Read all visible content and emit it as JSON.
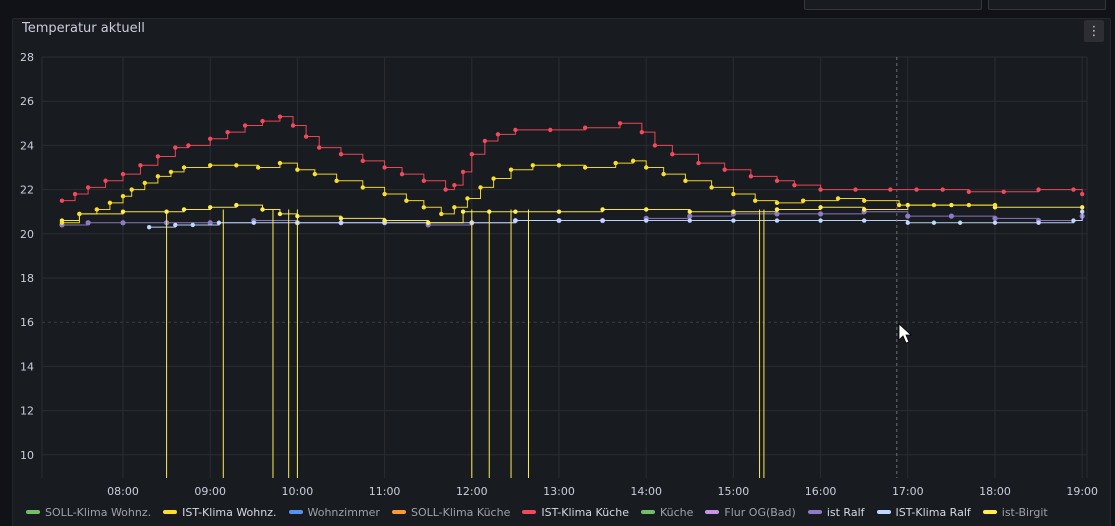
{
  "panel": {
    "title": "Temperatur aktuell",
    "menu_icon": "vertical-ellipsis-icon"
  },
  "chart_data": {
    "type": "line",
    "title": "Temperatur aktuell",
    "xlabel": "",
    "ylabel": "",
    "ylim": [
      9,
      28
    ],
    "y_ticks": [
      10,
      12,
      14,
      16,
      18,
      20,
      22,
      24,
      26,
      28
    ],
    "xlim": [
      "07:15",
      "19:05"
    ],
    "x_ticks": [
      "08:00",
      "09:00",
      "10:00",
      "11:00",
      "12:00",
      "13:00",
      "14:00",
      "15:00",
      "16:00",
      "17:00",
      "18:00",
      "19:00"
    ],
    "grid": true,
    "legend_position": "bottom",
    "series": [
      {
        "name": "SOLL-Klima Wohnz.",
        "color": "#73bf69",
        "values": []
      },
      {
        "name": "IST-Klima Wohnz.",
        "color": "#fade2a",
        "values": [
          [
            7.3,
            20.5
          ],
          [
            7.5,
            20.9
          ],
          [
            7.7,
            21.1
          ],
          [
            7.85,
            21.4
          ],
          [
            8.0,
            21.7
          ],
          [
            8.1,
            22.0
          ],
          [
            8.25,
            22.3
          ],
          [
            8.4,
            22.6
          ],
          [
            8.55,
            22.8
          ],
          [
            8.7,
            23.0
          ],
          [
            9.0,
            23.1
          ],
          [
            9.3,
            23.1
          ],
          [
            9.55,
            23.0
          ],
          [
            9.8,
            23.2
          ],
          [
            10.0,
            22.9
          ],
          [
            10.2,
            22.7
          ],
          [
            10.45,
            22.4
          ],
          [
            10.75,
            22.1
          ],
          [
            11.0,
            21.8
          ],
          [
            11.25,
            21.5
          ],
          [
            11.45,
            21.2
          ],
          [
            11.65,
            20.9
          ],
          [
            11.8,
            21.2
          ],
          [
            11.95,
            21.6
          ],
          [
            12.1,
            22.1
          ],
          [
            12.25,
            22.5
          ],
          [
            12.45,
            22.9
          ],
          [
            12.7,
            23.1
          ],
          [
            13.0,
            23.1
          ],
          [
            13.3,
            23.0
          ],
          [
            13.65,
            23.2
          ],
          [
            13.85,
            23.3
          ],
          [
            14.0,
            23.0
          ],
          [
            14.2,
            22.7
          ],
          [
            14.45,
            22.4
          ],
          [
            14.75,
            22.1
          ],
          [
            15.0,
            21.8
          ],
          [
            15.25,
            21.5
          ],
          [
            15.5,
            21.4
          ],
          [
            15.8,
            21.5
          ],
          [
            16.2,
            21.6
          ],
          [
            16.5,
            21.5
          ],
          [
            16.9,
            21.3
          ],
          [
            17.3,
            21.3
          ],
          [
            17.7,
            21.3
          ],
          [
            18.0,
            21.3
          ]
        ]
      },
      {
        "name": "Wohnzimmer",
        "color": "#5794f2",
        "values": []
      },
      {
        "name": "SOLL-Klima Küche",
        "color": "#ff9830",
        "values": []
      },
      {
        "name": "IST-Klima Küche",
        "color": "#f2495c",
        "values": [
          [
            7.3,
            21.5
          ],
          [
            7.45,
            21.8
          ],
          [
            7.6,
            22.1
          ],
          [
            7.8,
            22.4
          ],
          [
            8.0,
            22.7
          ],
          [
            8.2,
            23.1
          ],
          [
            8.4,
            23.5
          ],
          [
            8.6,
            23.9
          ],
          [
            8.75,
            24.0
          ],
          [
            9.0,
            24.3
          ],
          [
            9.2,
            24.6
          ],
          [
            9.4,
            24.9
          ],
          [
            9.6,
            25.1
          ],
          [
            9.8,
            25.3
          ],
          [
            9.95,
            24.9
          ],
          [
            10.1,
            24.4
          ],
          [
            10.25,
            23.9
          ],
          [
            10.5,
            23.6
          ],
          [
            10.75,
            23.3
          ],
          [
            11.0,
            23.0
          ],
          [
            11.2,
            22.7
          ],
          [
            11.45,
            22.4
          ],
          [
            11.7,
            22.0
          ],
          [
            11.8,
            22.2
          ],
          [
            11.9,
            22.8
          ],
          [
            12.0,
            23.6
          ],
          [
            12.15,
            24.2
          ],
          [
            12.3,
            24.5
          ],
          [
            12.5,
            24.7
          ],
          [
            12.9,
            24.7
          ],
          [
            13.3,
            24.8
          ],
          [
            13.7,
            25.0
          ],
          [
            13.95,
            24.6
          ],
          [
            14.1,
            24.0
          ],
          [
            14.3,
            23.6
          ],
          [
            14.6,
            23.2
          ],
          [
            14.9,
            22.9
          ],
          [
            15.2,
            22.6
          ],
          [
            15.5,
            22.4
          ],
          [
            15.7,
            22.2
          ],
          [
            16.0,
            22.0
          ],
          [
            16.4,
            22.0
          ],
          [
            16.8,
            22.0
          ],
          [
            17.1,
            22.0
          ],
          [
            17.4,
            22.0
          ],
          [
            17.7,
            21.9
          ],
          [
            18.1,
            21.9
          ],
          [
            18.5,
            22.0
          ],
          [
            18.9,
            22.0
          ],
          [
            19.0,
            21.8
          ]
        ]
      },
      {
        "name": "Küche",
        "color": "#73bf69",
        "values": []
      },
      {
        "name": "Flur OG(Bad)",
        "color": "#ca95e5",
        "values": []
      },
      {
        "name": "ist Ralf",
        "color": "#8f7ac7",
        "values": [
          [
            7.3,
            20.4
          ],
          [
            7.6,
            20.5
          ],
          [
            8.0,
            20.5
          ],
          [
            8.5,
            20.5
          ],
          [
            9.0,
            20.5
          ],
          [
            9.5,
            20.6
          ],
          [
            10.0,
            20.5
          ],
          [
            10.5,
            20.5
          ],
          [
            11.0,
            20.5
          ],
          [
            11.5,
            20.4
          ],
          [
            12.0,
            20.5
          ],
          [
            12.5,
            20.6
          ],
          [
            13.0,
            20.6
          ],
          [
            13.5,
            20.6
          ],
          [
            14.0,
            20.7
          ],
          [
            14.5,
            20.8
          ],
          [
            15.0,
            20.9
          ],
          [
            15.5,
            20.9
          ],
          [
            16.0,
            20.9
          ],
          [
            16.5,
            21.0
          ],
          [
            17.0,
            20.8
          ],
          [
            17.5,
            20.8
          ],
          [
            18.0,
            20.7
          ],
          [
            18.5,
            20.6
          ],
          [
            19.0,
            20.8
          ]
        ]
      },
      {
        "name": "IST-Klima Ralf",
        "color": "#c0d8ff",
        "values": [
          [
            8.3,
            20.3
          ],
          [
            8.6,
            20.4
          ],
          [
            8.8,
            20.4
          ],
          [
            9.1,
            20.5
          ],
          [
            9.5,
            20.5
          ],
          [
            10.0,
            20.5
          ],
          [
            10.5,
            20.5
          ],
          [
            11.0,
            20.5
          ],
          [
            11.5,
            20.5
          ],
          [
            12.0,
            20.5
          ],
          [
            12.5,
            20.6
          ],
          [
            13.0,
            20.6
          ],
          [
            13.5,
            20.6
          ],
          [
            14.0,
            20.6
          ],
          [
            14.5,
            20.6
          ],
          [
            15.0,
            20.6
          ],
          [
            15.5,
            20.6
          ],
          [
            16.0,
            20.6
          ],
          [
            16.5,
            20.6
          ],
          [
            17.0,
            20.5
          ],
          [
            17.3,
            20.5
          ],
          [
            17.6,
            20.5
          ],
          [
            18.0,
            20.5
          ],
          [
            18.5,
            20.5
          ],
          [
            18.9,
            20.6
          ],
          [
            19.0,
            21.0
          ]
        ]
      },
      {
        "name": "ist-Birgit",
        "color": "#ffee52",
        "values": [
          [
            7.3,
            20.6
          ],
          [
            7.5,
            20.9
          ],
          [
            8.0,
            21.0
          ],
          [
            8.5,
            21.0
          ],
          [
            8.7,
            21.1
          ],
          [
            9.0,
            21.2
          ],
          [
            9.3,
            21.3
          ],
          [
            9.6,
            21.1
          ],
          [
            9.8,
            20.9
          ],
          [
            10.0,
            20.8
          ],
          [
            10.5,
            20.7
          ],
          [
            11.0,
            20.6
          ],
          [
            11.5,
            20.5
          ],
          [
            11.9,
            21.0
          ],
          [
            12.2,
            21.0
          ],
          [
            12.5,
            21.0
          ],
          [
            13.0,
            21.0
          ],
          [
            13.5,
            21.1
          ],
          [
            14.0,
            21.1
          ],
          [
            14.5,
            21.0
          ],
          [
            15.0,
            21.0
          ],
          [
            15.5,
            21.1
          ],
          [
            16.0,
            21.2
          ],
          [
            16.5,
            21.1
          ],
          [
            17.0,
            21.3
          ],
          [
            17.5,
            21.3
          ],
          [
            18.0,
            21.2
          ],
          [
            19.0,
            21.2
          ]
        ]
      }
    ],
    "dips": {
      "series": "ist-Birgit",
      "to_value": 9,
      "at_times": [
        8.5,
        9.15,
        9.72,
        9.9,
        10.0,
        12.0,
        12.2,
        12.45,
        12.65,
        15.3,
        15.35
      ]
    },
    "annotation_time": 17.0
  },
  "legend": [
    {
      "label": "SOLL-Klima Wohnz.",
      "color": "#73bf69"
    },
    {
      "label": "IST-Klima Wohnz.",
      "color": "#fade2a"
    },
    {
      "label": "Wohnzimmer",
      "color": "#5794f2"
    },
    {
      "label": "SOLL-Klima Küche",
      "color": "#ff9830"
    },
    {
      "label": "IST-Klima Küche",
      "color": "#f2495c"
    },
    {
      "label": "Küche",
      "color": "#73bf69"
    },
    {
      "label": "Flur OG(Bad)",
      "color": "#ca95e5"
    },
    {
      "label": "ist Ralf",
      "color": "#8f7ac7"
    },
    {
      "label": "IST-Klima Ralf",
      "color": "#c0d8ff"
    },
    {
      "label": "ist-Birgit",
      "color": "#ffee52"
    }
  ]
}
